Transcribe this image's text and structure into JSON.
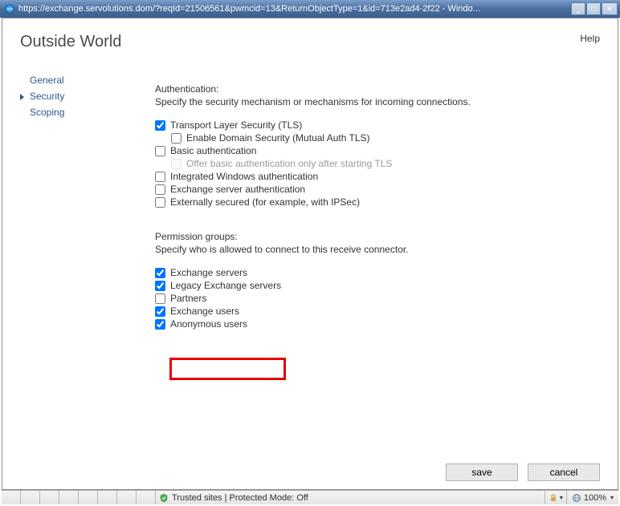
{
  "window": {
    "url": "https://exchange.servolutions.dom/?reqId=21506561&pwmcid=13&ReturnObjectType=1&id=713e2ad4-2f22",
    "title_suffix": " - Windo..."
  },
  "page": {
    "title": "Outside World",
    "help": "Help"
  },
  "sidebar": {
    "items": [
      {
        "label": "General",
        "active": false
      },
      {
        "label": "Security",
        "active": true
      },
      {
        "label": "Scoping",
        "active": false
      }
    ]
  },
  "auth_section": {
    "title": "Authentication:",
    "desc": "Specify the security mechanism or mechanisms for incoming connections.",
    "options": [
      {
        "label": "Transport Layer Security (TLS)",
        "checked": true,
        "indent": 1,
        "disabled": false
      },
      {
        "label": "Enable Domain Security (Mutual Auth TLS)",
        "checked": false,
        "indent": 2,
        "disabled": false
      },
      {
        "label": "Basic authentication",
        "checked": false,
        "indent": 1,
        "disabled": false
      },
      {
        "label": "Offer basic authentication only after starting TLS",
        "checked": false,
        "indent": 2,
        "disabled": true
      },
      {
        "label": "Integrated Windows authentication",
        "checked": false,
        "indent": 1,
        "disabled": false
      },
      {
        "label": "Exchange server authentication",
        "checked": false,
        "indent": 1,
        "disabled": false
      },
      {
        "label": "Externally secured (for example, with IPSec)",
        "checked": false,
        "indent": 1,
        "disabled": false
      }
    ]
  },
  "perm_section": {
    "title": "Permission groups:",
    "desc": "Specify who is allowed to connect to this receive connector.",
    "options": [
      {
        "label": "Exchange servers",
        "checked": true
      },
      {
        "label": "Legacy Exchange servers",
        "checked": true
      },
      {
        "label": "Partners",
        "checked": false
      },
      {
        "label": "Exchange users",
        "checked": true
      },
      {
        "label": "Anonymous users",
        "checked": true
      }
    ]
  },
  "buttons": {
    "save": "save",
    "cancel": "cancel"
  },
  "statusbar": {
    "zone": "Trusted sites",
    "protected_mode": "Protected Mode: Off",
    "zoom": "100%"
  }
}
